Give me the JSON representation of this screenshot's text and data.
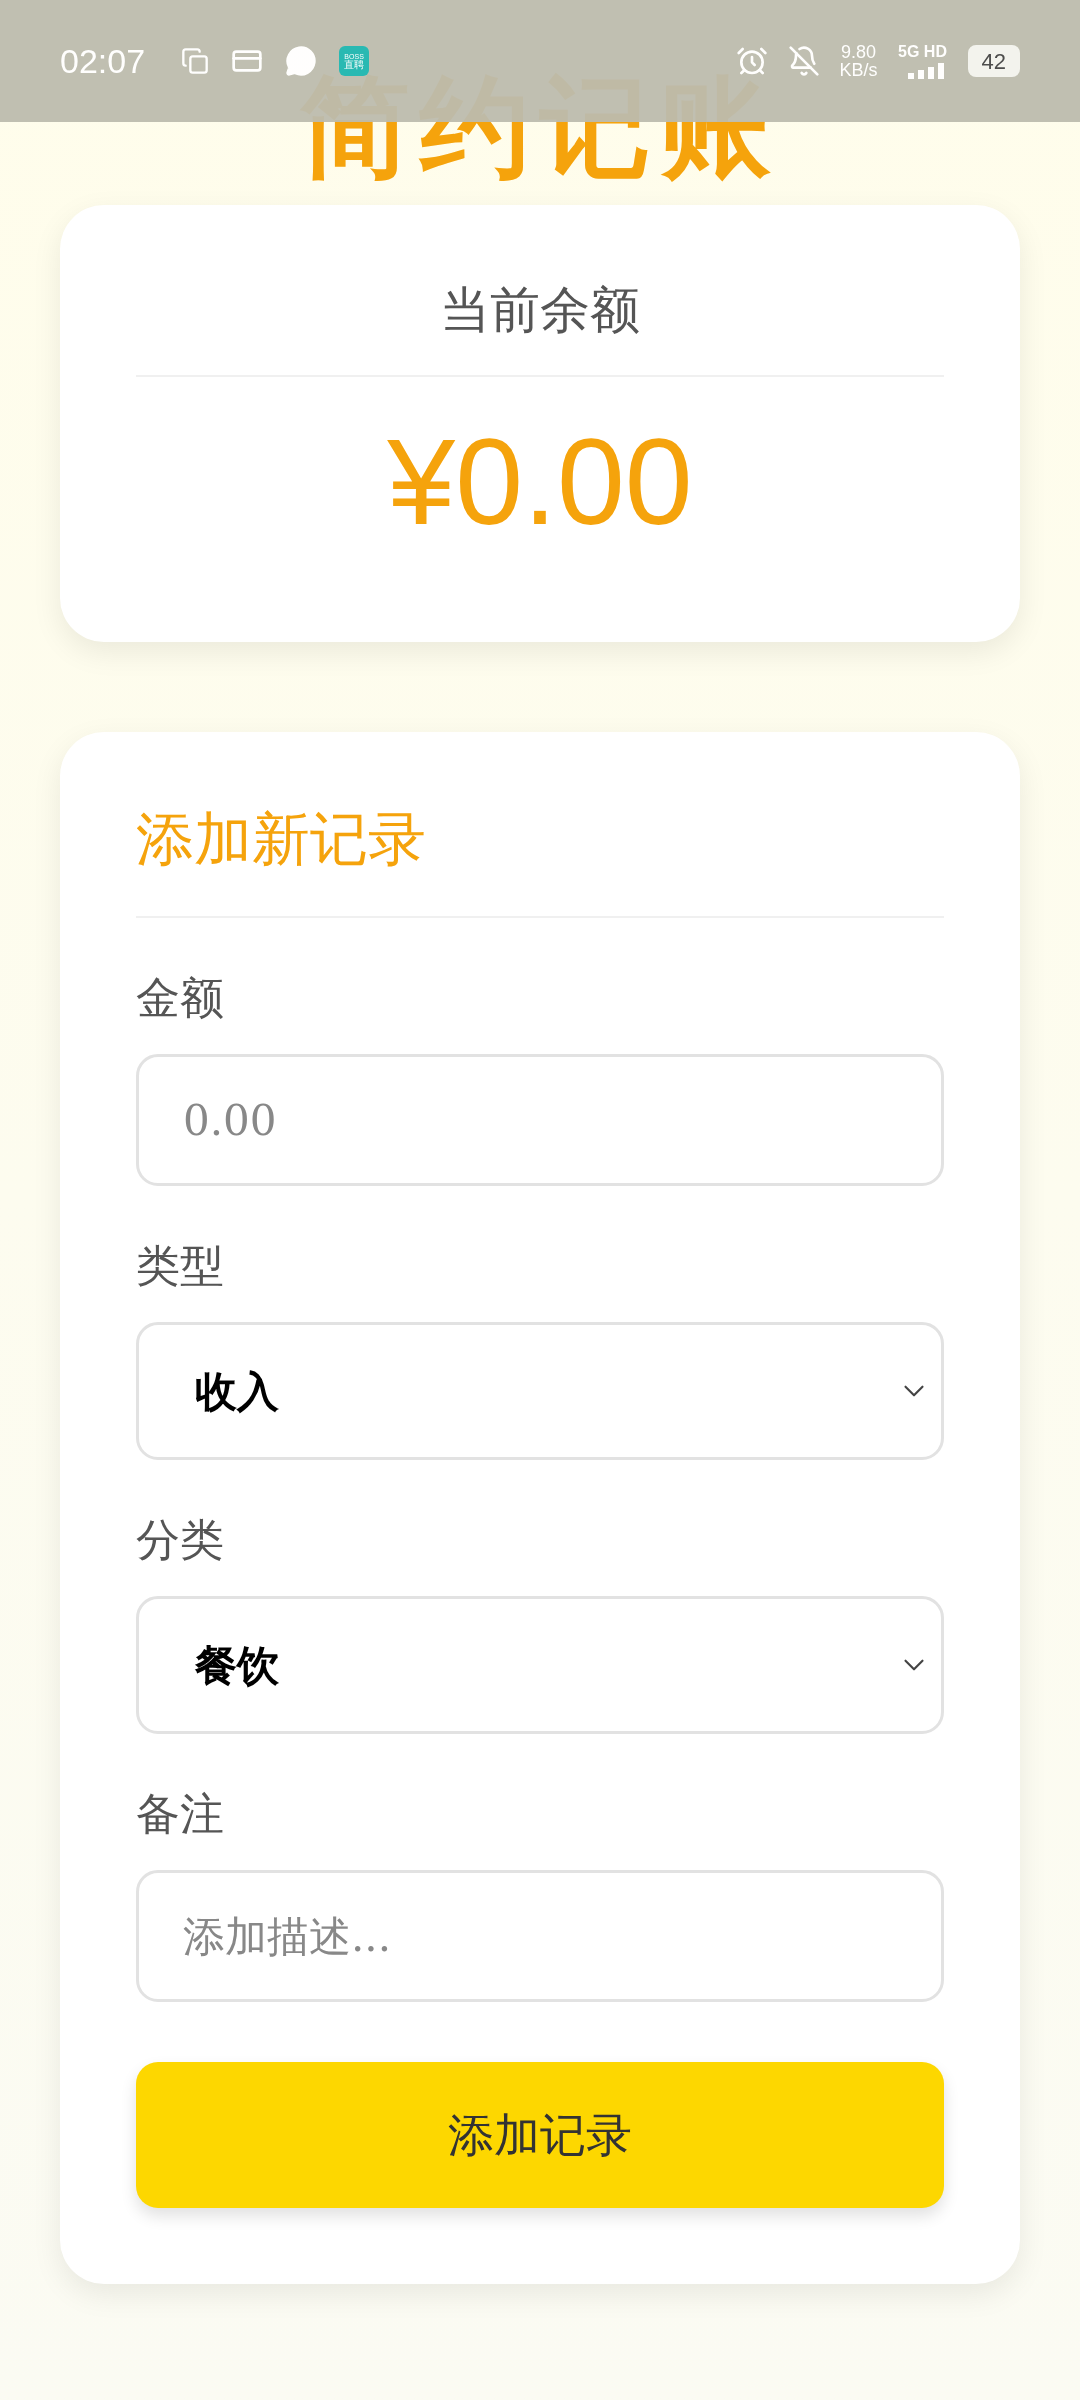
{
  "status_bar": {
    "time": "02:07",
    "app_badge": [
      "BOSS",
      "直聘"
    ],
    "net_speed": [
      "9.80",
      "KB/s"
    ],
    "network": "5G HD",
    "battery": "42"
  },
  "title": "简约记账",
  "balance_card": {
    "label": "当前余额",
    "amount": "¥0.00"
  },
  "form": {
    "heading": "添加新记录",
    "fields": [
      {
        "kind": "input",
        "label": "金额",
        "placeholder": "0.00"
      },
      {
        "kind": "select",
        "label": "类型",
        "value": "收入"
      },
      {
        "kind": "select",
        "label": "分类",
        "value": "餐饮"
      },
      {
        "kind": "input",
        "label": "备注",
        "placeholder": "添加描述..."
      }
    ],
    "submit": "添加记录"
  }
}
